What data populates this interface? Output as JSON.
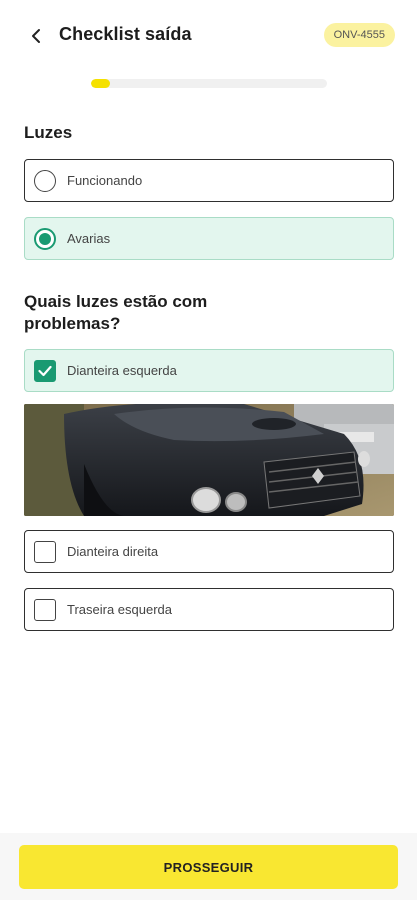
{
  "header": {
    "title": "Checklist saída",
    "plate": "ONV-4555"
  },
  "progress": 0.08,
  "section_lights": {
    "title": "Luzes",
    "options": [
      {
        "label": "Funcionando",
        "selected": false
      },
      {
        "label": "Avarias",
        "selected": true
      }
    ]
  },
  "section_problems": {
    "title": "Quais luzes estão com problemas?",
    "items": [
      {
        "label": "Dianteira esquerda",
        "checked": true
      },
      {
        "label": "Dianteira direita",
        "checked": false
      },
      {
        "label": "Traseira esquerda",
        "checked": false
      }
    ]
  },
  "footer": {
    "button_label": "PROSSEGUIR"
  },
  "colors": {
    "accent_green": "#1a9a72",
    "selected_bg": "#e3f6ee",
    "primary_yellow": "#f9e731",
    "badge_yellow": "#fbf2a0"
  },
  "icons": {
    "back": "chevron-left-icon",
    "check": "check-icon"
  }
}
